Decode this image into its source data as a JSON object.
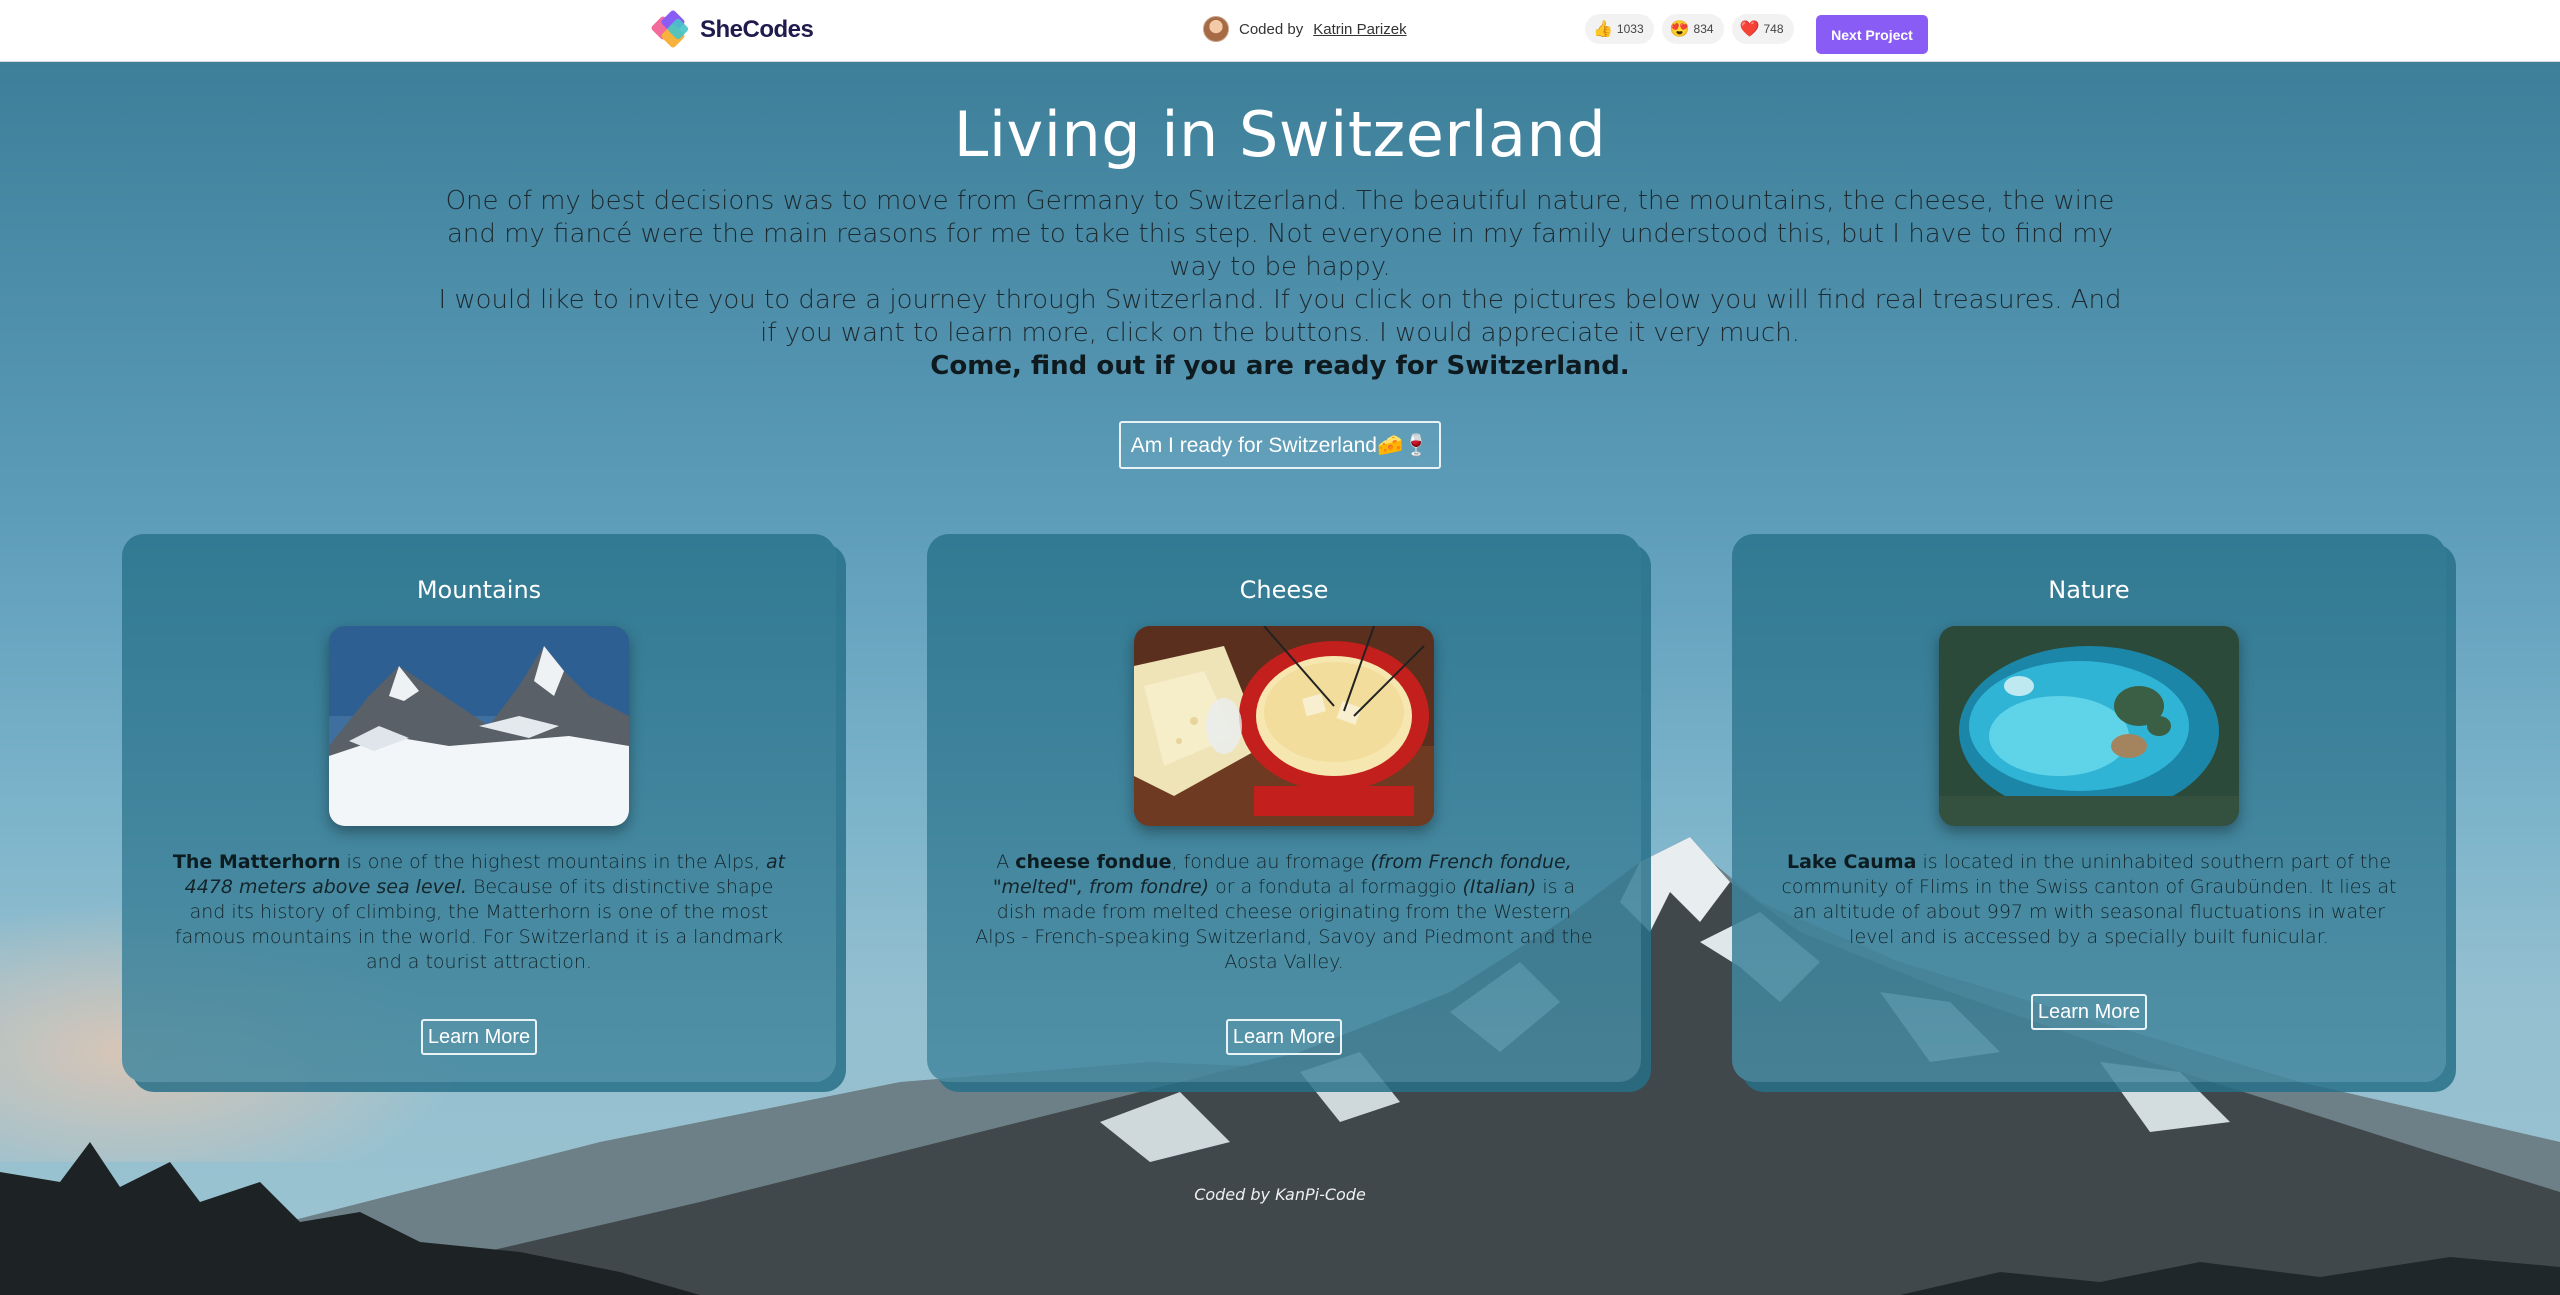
{
  "topbar": {
    "brand": "SheCodes",
    "coded_by_prefix": "Coded by",
    "coded_by_name": "Katrin Parizek",
    "reactions": [
      {
        "icon": "thumbs-up-icon",
        "emoji": "👍",
        "count": "1033"
      },
      {
        "icon": "heart-eyes-icon",
        "emoji": "😍",
        "count": "834"
      },
      {
        "icon": "heart-icon",
        "emoji": "❤️",
        "count": "748"
      }
    ],
    "next_label": "Next Project"
  },
  "hero": {
    "title": "Living in Switzerland",
    "paragraph1": "One of my best decisions was to move from Germany to Switzerland. The beautiful nature, the mountains, the cheese, the wine and my fiancé were the main reasons for me to take this step. Not everyone in my family understood this, but I have to find my way to be happy.",
    "paragraph2": "I would like to invite you to dare a journey through Switzerland. If you click on the pictures below you will find real treasures. And if you want to learn more, click on the buttons. I would appreciate it very much.",
    "call_to_action": "Come, find out if you are ready for Switzerland.",
    "ready_button": "Am I ready for Switzerland🧀🍷"
  },
  "cards": [
    {
      "title": "Mountains",
      "image": "matterhorn-photo",
      "desc_bold": "The Matterhorn",
      "desc_a": " is one of the highest mountains in the Alps, ",
      "desc_italic": "at 4478 meters above sea level.",
      "desc_b": " Because of its distinctive shape and its history of climbing, the Matterhorn is one of the most famous mountains in the world. For Switzerland it is a landmark and a tourist attraction.",
      "button": "Learn More"
    },
    {
      "title": "Cheese",
      "image": "fondue-photo",
      "desc_pre": "A ",
      "desc_bold": "cheese fondue",
      "desc_a": ", fondue au fromage ",
      "desc_italic": "(from French fondue, \"melted\", from fondre)",
      "desc_b": " or a fonduta al formaggio ",
      "desc_italic2": "(Italian)",
      "desc_c": " is a dish made from melted cheese originating from the Western Alps - French-speaking Switzerland, Savoy and Piedmont and the Aosta Valley.",
      "button": "Learn More"
    },
    {
      "title": "Nature",
      "image": "lake-cauma-photo",
      "desc_bold": "Lake Cauma",
      "desc_a": " is located in the uninhabited southern part of the community of Flims in the Swiss canton of Graubünden. It lies at an altitude of about 997 m with seasonal fluctuations in water level and is accessed by a specially built funicular.",
      "button": "Learn More"
    }
  ],
  "footer": "Coded by KanPi-Code",
  "colors": {
    "accent": "#8a5cf6",
    "card": "#2e768f",
    "sky": "#4a8eab"
  }
}
